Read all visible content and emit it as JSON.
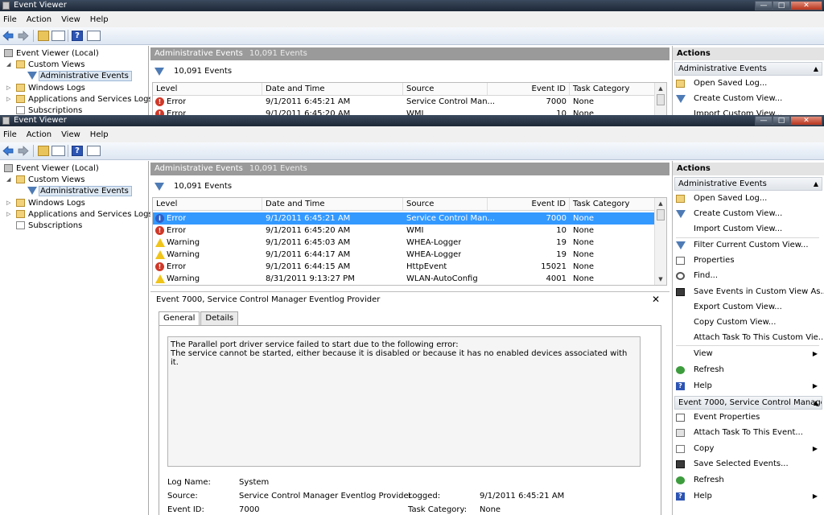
{
  "window": {
    "title": "Event Viewer",
    "min_glyph": "—",
    "max_glyph": "□",
    "close_glyph": "✕"
  },
  "menu": [
    "File",
    "Action",
    "View",
    "Help"
  ],
  "toolbar": {
    "help_glyph": "?"
  },
  "tree": {
    "root": "Event Viewer (Local)",
    "custom_views": "Custom Views",
    "admin_events": "Administrative Events",
    "windows_logs": "Windows Logs",
    "apps_services": "Applications and Services Logs",
    "subscriptions": "Subscriptions"
  },
  "center": {
    "header_title": "Administrative Events",
    "header_count": "10,091 Events",
    "filter_count": "10,091 Events",
    "columns": {
      "level": "Level",
      "date": "Date and Time",
      "source": "Source",
      "event_id": "Event ID",
      "task": "Task Category"
    },
    "rows": [
      {
        "level": "Error",
        "date": "9/1/2011 6:45:21 AM",
        "source": "Service Control Man...",
        "event_id": "7000",
        "task": "None"
      },
      {
        "level": "Error",
        "date": "9/1/2011 6:45:20 AM",
        "source": "WMI",
        "event_id": "10",
        "task": "None"
      },
      {
        "level": "Warning",
        "date": "9/1/2011 6:45:03 AM",
        "source": "WHEA-Logger",
        "event_id": "19",
        "task": "None"
      },
      {
        "level": "Warning",
        "date": "9/1/2011 6:44:17 AM",
        "source": "WHEA-Logger",
        "event_id": "19",
        "task": "None"
      },
      {
        "level": "Error",
        "date": "9/1/2011 6:44:15 AM",
        "source": "HttpEvent",
        "event_id": "15021",
        "task": "None"
      },
      {
        "level": "Warning",
        "date": "8/31/2011 9:13:27 PM",
        "source": "WLAN-AutoConfig",
        "event_id": "4001",
        "task": "None"
      }
    ]
  },
  "detail": {
    "title": "Event 7000, Service Control Manager Eventlog Provider",
    "close_glyph": "✕",
    "tab_general": "General",
    "tab_details": "Details",
    "message_line1": "The Parallel port driver service failed to start due to the following error:",
    "message_line2": "The service cannot be started, either because it is disabled or because it has no enabled devices associated with it.",
    "log_name_label": "Log Name:",
    "log_name": "System",
    "source_label": "Source:",
    "source": "Service Control Manager Eventlog Provider",
    "logged_label": "Logged:",
    "logged": "9/1/2011 6:45:21 AM",
    "event_id_label": "Event ID:",
    "event_id": "7000",
    "task_label": "Task Category:",
    "task": "None"
  },
  "actions": {
    "header": "Actions",
    "section1": "Administrative Events",
    "section1_items": [
      "Open Saved Log...",
      "Create Custom View...",
      "Import Custom View...",
      "Filter Current Custom View...",
      "Properties",
      "Find...",
      "Save Events in Custom View As...",
      "Export Custom View...",
      "Copy Custom View...",
      "Attach Task To This Custom Vie...",
      "View",
      "Refresh",
      "Help"
    ],
    "section2": "Event 7000, Service Control Manager ...",
    "section2_items": [
      "Event Properties",
      "Attach Task To This Event...",
      "Copy",
      "Save Selected Events...",
      "Refresh",
      "Help"
    ]
  }
}
